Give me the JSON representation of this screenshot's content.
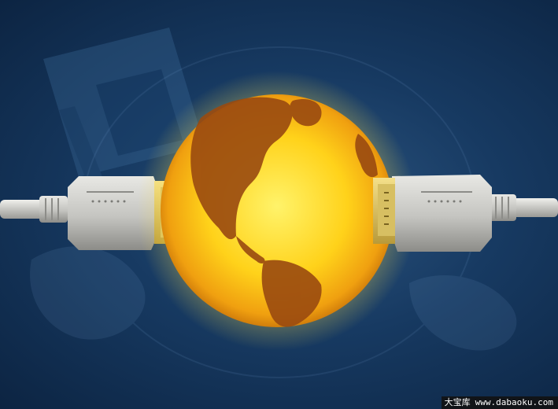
{
  "image": {
    "subject": "glowing globe between two connector plugs",
    "colors": {
      "background_dark": "#0c2442",
      "background_mid": "#2c5580",
      "globe_glow": "#ffe24a",
      "globe_core": "#ffd21a",
      "continents": "#9a4a10",
      "plug_body": "#c9c9c6",
      "cable": "#d4d4d0"
    }
  },
  "watermark": {
    "brand": "大宝库",
    "url": "www.dabaoku.com"
  }
}
